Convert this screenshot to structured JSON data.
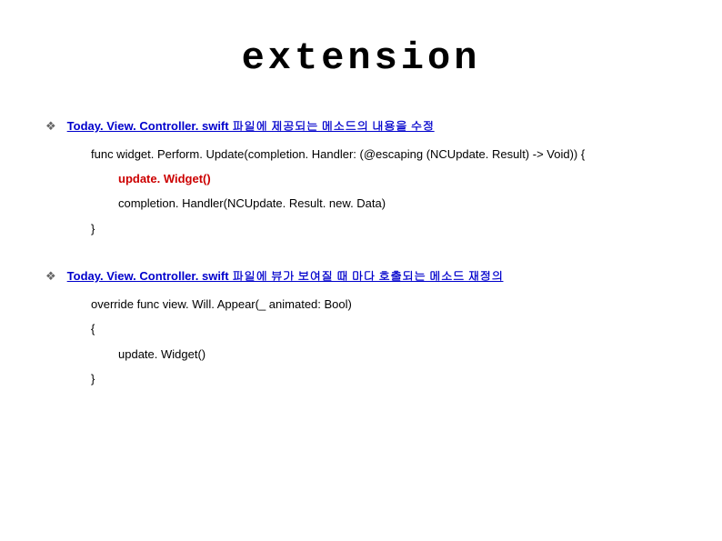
{
  "title": "extension",
  "sections": [
    {
      "heading": "Today. View. Controller. swift 파일에 제공되는 메소드의 내용을 수정",
      "code": [
        {
          "text": "func widget. Perform. Update(completion. Handler: (@escaping (NCUpdate. Result) -> Void)) {",
          "indent": 0,
          "highlight": false
        },
        {
          "text": "update. Widget()",
          "indent": 1,
          "highlight": true
        },
        {
          "text": "completion. Handler(NCUpdate. Result. new. Data)",
          "indent": 1,
          "highlight": false
        },
        {
          "text": "}",
          "indent": 0,
          "highlight": false
        }
      ]
    },
    {
      "heading": "Today. View. Controller. swift 파일에 뷰가 보여질 때 마다 호출되는 메소드 재정의",
      "code": [
        {
          "text": "override func view. Will. Appear(_ animated: Bool)",
          "indent": 0,
          "highlight": false
        },
        {
          "text": "{",
          "indent": 0,
          "highlight": false
        },
        {
          "text": "update. Widget()",
          "indent": 1,
          "highlight": false
        },
        {
          "text": "}",
          "indent": 0,
          "highlight": false
        }
      ]
    }
  ],
  "bullet_char": "❖"
}
